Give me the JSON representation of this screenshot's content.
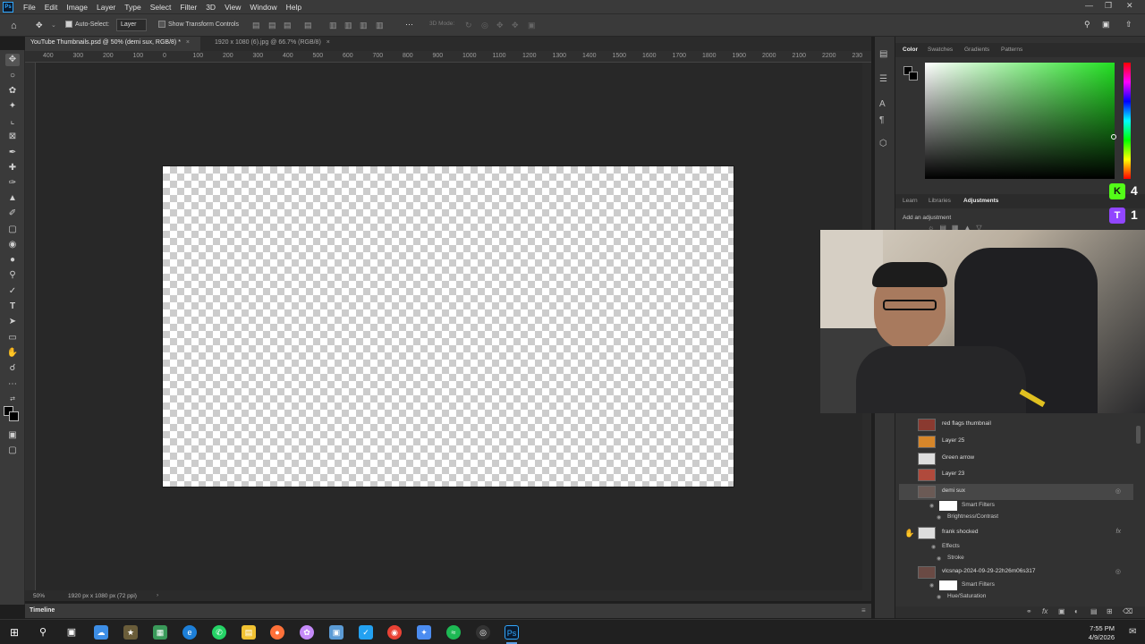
{
  "app": {
    "logo_text": "Ps"
  },
  "menu": [
    "File",
    "Edit",
    "Image",
    "Layer",
    "Type",
    "Select",
    "Filter",
    "3D",
    "View",
    "Window",
    "Help"
  ],
  "options": {
    "auto_select_label": "Auto-Select:",
    "auto_select_checked": true,
    "auto_select_target": "Layer",
    "transform_controls_label": "Show Transform Controls",
    "mode_3d_label": "3D Mode:"
  },
  "doc_tabs": [
    {
      "title": "YouTube Thumbnails.psd @ 50% (demi sux, RGB/8) *",
      "active": true
    },
    {
      "title": "1920 x 1080 (6).jpg @ 66.7% (RGB/8)",
      "active": false
    }
  ],
  "ruler_top": [
    "400",
    "300",
    "200",
    "100",
    "0",
    "100",
    "200",
    "300",
    "400",
    "500",
    "600",
    "700",
    "800",
    "900",
    "1000",
    "1100",
    "1200",
    "1300",
    "1400",
    "1500",
    "1600",
    "1700",
    "1800",
    "1900",
    "2000",
    "2100",
    "2200",
    "230"
  ],
  "status": {
    "zoom": "50%",
    "doc_size": "1920 px x 1080 px (72 ppi)"
  },
  "timeline_label": "Timeline",
  "color_panel": {
    "tabs": [
      "Color",
      "Swatches",
      "Gradients",
      "Patterns"
    ],
    "active_tab": "Color",
    "foreground": "#000000",
    "background": "#000000",
    "hue_color": "#22e022"
  },
  "adjust_panel": {
    "tabs": [
      "Learn",
      "Libraries",
      "Adjustments"
    ],
    "active_tab": "Adjustments",
    "hint": "Add an adjustment"
  },
  "overlay_badges": [
    {
      "letter": "K",
      "count": "4",
      "color": "#53fc18"
    },
    {
      "letter": "T",
      "count": "1",
      "color": "#9146ff"
    }
  ],
  "layers": [
    {
      "name": "red flags thumbnail",
      "selected": false
    },
    {
      "name": "Layer 25",
      "selected": false
    },
    {
      "name": "Green arrow",
      "selected": false
    },
    {
      "name": "Layer 23",
      "selected": false
    },
    {
      "name": "demi sux",
      "selected": true
    },
    {
      "name": "Smart Filters",
      "sub": true
    },
    {
      "name": "Brightness/Contrast",
      "sub": true
    },
    {
      "name": "frank shocked",
      "selected": false
    },
    {
      "name": "Effects",
      "sub": true
    },
    {
      "name": "Stroke",
      "sub": true
    },
    {
      "name": "vlcsnap-2024-09-29-22h26m06s317",
      "selected": false
    },
    {
      "name": "Smart Filters",
      "sub": true
    },
    {
      "name": "Hue/Saturation",
      "sub": true
    }
  ],
  "clock": {
    "time": "7:55 PM",
    "date": "4/9/2026"
  }
}
